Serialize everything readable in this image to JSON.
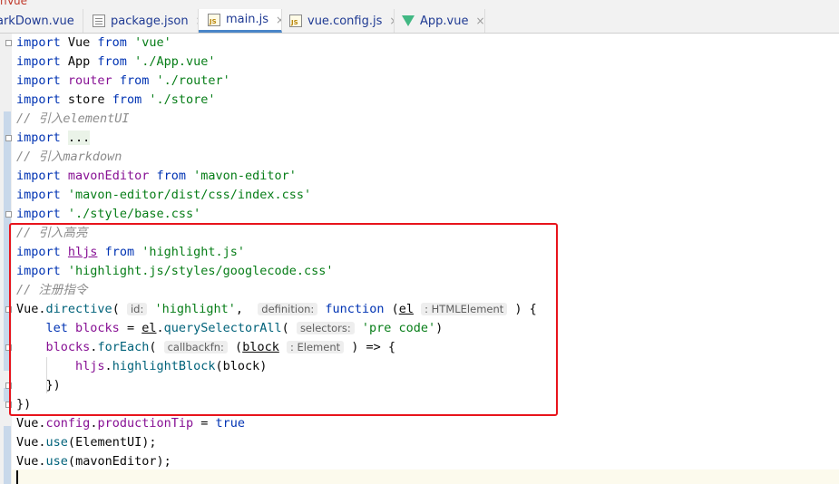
{
  "top_title": "nVue",
  "tabs": [
    {
      "label": "arkDown.vue",
      "icon": "vue-file-icon"
    },
    {
      "label": "package.json",
      "icon": "json-file-icon"
    },
    {
      "label": "main.js",
      "icon": "js-file-icon",
      "active": true
    },
    {
      "label": "vue.config.js",
      "icon": "js-file-icon"
    },
    {
      "label": "App.vue",
      "icon": "vue-file-icon"
    }
  ],
  "close_glyph": "×",
  "code": {
    "l1": {
      "a": "import",
      "b": " Vue ",
      "c": "from",
      "d": "'vue'"
    },
    "l2": {
      "a": "import",
      "b": " App ",
      "c": "from",
      "d": "'./App.vue'"
    },
    "l3": {
      "a": "import",
      "b": "router",
      "c": "from",
      "d": "'./router'"
    },
    "l4": {
      "a": "import",
      "b": " store ",
      "c": "from",
      "d": "'./store'"
    },
    "l5": "// 引入elementUI",
    "l6": {
      "a": "import",
      "b": "..."
    },
    "l7": "// 引入markdown",
    "l8": {
      "a": "import",
      "b": "mavonEditor",
      "c": "from",
      "d": "'mavon-editor'"
    },
    "l9": {
      "a": "import",
      "d": "'mavon-editor/dist/css/index.css'"
    },
    "l10": {
      "a": "import",
      "d": "'./style/base.css'"
    },
    "l11": "// 引入高亮",
    "l12": {
      "a": "import",
      "b": "hljs",
      "c": "from",
      "d": "'highlight.js'"
    },
    "l13": {
      "a": "import",
      "d": "'highlight.js/styles/googlecode.css'"
    },
    "l14": "// 注册指令",
    "l15": {
      "obj": "Vue",
      "method": "directive",
      "hint_id": "id:",
      "str": "'highlight'",
      "hint_def": "definition:",
      "kw": "function",
      "param": "el",
      "hint_type": ": HTMLElement",
      "tail": ") {"
    },
    "l16": {
      "kw": "let",
      "var": "blocks",
      "eq": " = ",
      "obj": "el",
      "method": "querySelectorAll",
      "hint": "selectors:",
      "str": "'pre code'",
      "tail": ")"
    },
    "l17": {
      "obj": "blocks",
      "method": "forEach",
      "hint": "callbackfn:",
      "param": "block",
      "hint_type": ": Element",
      "tail": ") => {"
    },
    "l18": {
      "obj": "hljs",
      "method": "highlightBlock",
      "arg": "block",
      "tail": ")"
    },
    "l19": "})",
    "l20": "})",
    "l21": {
      "obj": "Vue",
      "prop1": "config",
      "prop2": "productionTip",
      "eq": " = ",
      "kw": "true"
    },
    "l22": {
      "obj": "Vue",
      "method": "use",
      "arg": "ElementUI",
      "tail": ");"
    },
    "l23": {
      "obj": "Vue",
      "method": "use",
      "arg": "mavonEditor",
      "tail": ");"
    }
  },
  "colors": {
    "highlight_box": "#e8141c",
    "keyword": "#0033b3",
    "string": "#067d17",
    "comment": "#8c8c8c"
  }
}
